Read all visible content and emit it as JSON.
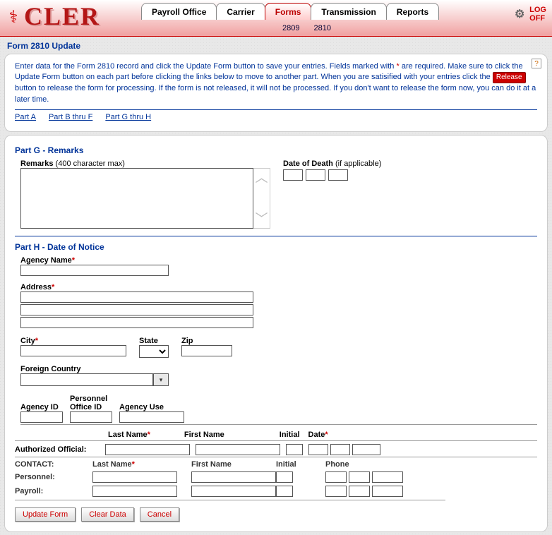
{
  "app": {
    "logo_text": "CLER"
  },
  "tabs": {
    "items": [
      "Payroll Office",
      "Carrier",
      "Forms",
      "Transmission",
      "Reports"
    ],
    "active_index": 2,
    "sub_items": [
      "2809",
      "2810"
    ]
  },
  "logoff": {
    "line1": "LOG",
    "line2": "OFF"
  },
  "page": {
    "title": "Form 2810 Update"
  },
  "instructions": {
    "text1": "Enter data for the Form 2810 record and click the Update Form button to save your entries.  Fields marked with ",
    "star": "*",
    "text2": " are required.  Make sure to click the Update Form button on each part before clicking the links below to move to another part.  When you are satisified with your entries click the ",
    "release_label": "Release",
    "text3": " button to release the form for processing.  If the form is not released, it will not be processed.  If you don't want to release the form now, you can do it at a later time."
  },
  "part_links": [
    "Part A",
    "Part B thru F",
    "Part G thru H"
  ],
  "partG": {
    "heading": "Part G - Remarks",
    "remarks_label": "Remarks",
    "remarks_note": "(400 character max)",
    "dod_label": "Date of Death",
    "dod_note": "(if applicable)"
  },
  "partH": {
    "heading": "Part H - Date of Notice",
    "agency_name": "Agency Name",
    "address": "Address",
    "city": "City",
    "state": "State",
    "zip": "Zip",
    "foreign_country": "Foreign Country",
    "agency_id": "Agency ID",
    "personnel_office_id_l1": "Personnel",
    "personnel_office_id_l2": "Office ID",
    "agency_use": "Agency Use",
    "last_name": "Last Name",
    "first_name": "First Name",
    "initial": "Initial",
    "date": "Date",
    "authorized_official": "Authorized Official:",
    "contact": "CONTACT:",
    "personnel": "Personnel:",
    "payroll": "Payroll:",
    "phone": "Phone"
  },
  "buttons": {
    "update": "Update Form",
    "clear": "Clear Data",
    "cancel": "Cancel"
  }
}
